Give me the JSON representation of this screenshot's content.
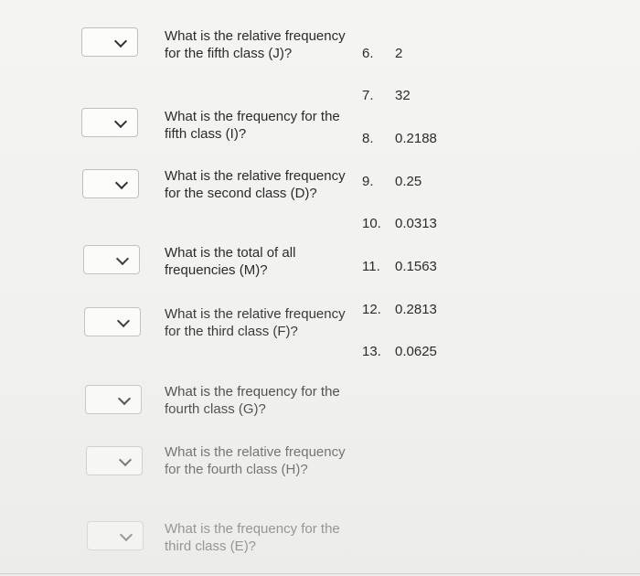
{
  "questions": [
    {
      "text": "What is the relative frequency for the fifth class (J)?",
      "selected": ""
    },
    {
      "text": "What is the frequency for the fifth class (I)?",
      "selected": ""
    },
    {
      "text": "What is the relative frequency for the second class (D)?",
      "selected": ""
    },
    {
      "text": "What is the total of all frequencies (M)?",
      "selected": ""
    },
    {
      "text": "What is the relative frequency for the third class (F)?",
      "selected": ""
    },
    {
      "text": "What is the frequency for the fourth class (G)?",
      "selected": ""
    },
    {
      "text": "What is the relative frequency for the fourth class (H)?",
      "selected": ""
    },
    {
      "text": "What is the frequency for the third class (E)?",
      "selected": ""
    }
  ],
  "options": [
    {
      "num": "6.",
      "value": "2"
    },
    {
      "num": "7.",
      "value": "32"
    },
    {
      "num": "8.",
      "value": "0.2188"
    },
    {
      "num": "9.",
      "value": "0.25"
    },
    {
      "num": "10.",
      "value": "0.0313"
    },
    {
      "num": "11.",
      "value": "0.1563"
    },
    {
      "num": "12.",
      "value": "0.2813"
    },
    {
      "num": "13.",
      "value": "0.0625"
    }
  ]
}
